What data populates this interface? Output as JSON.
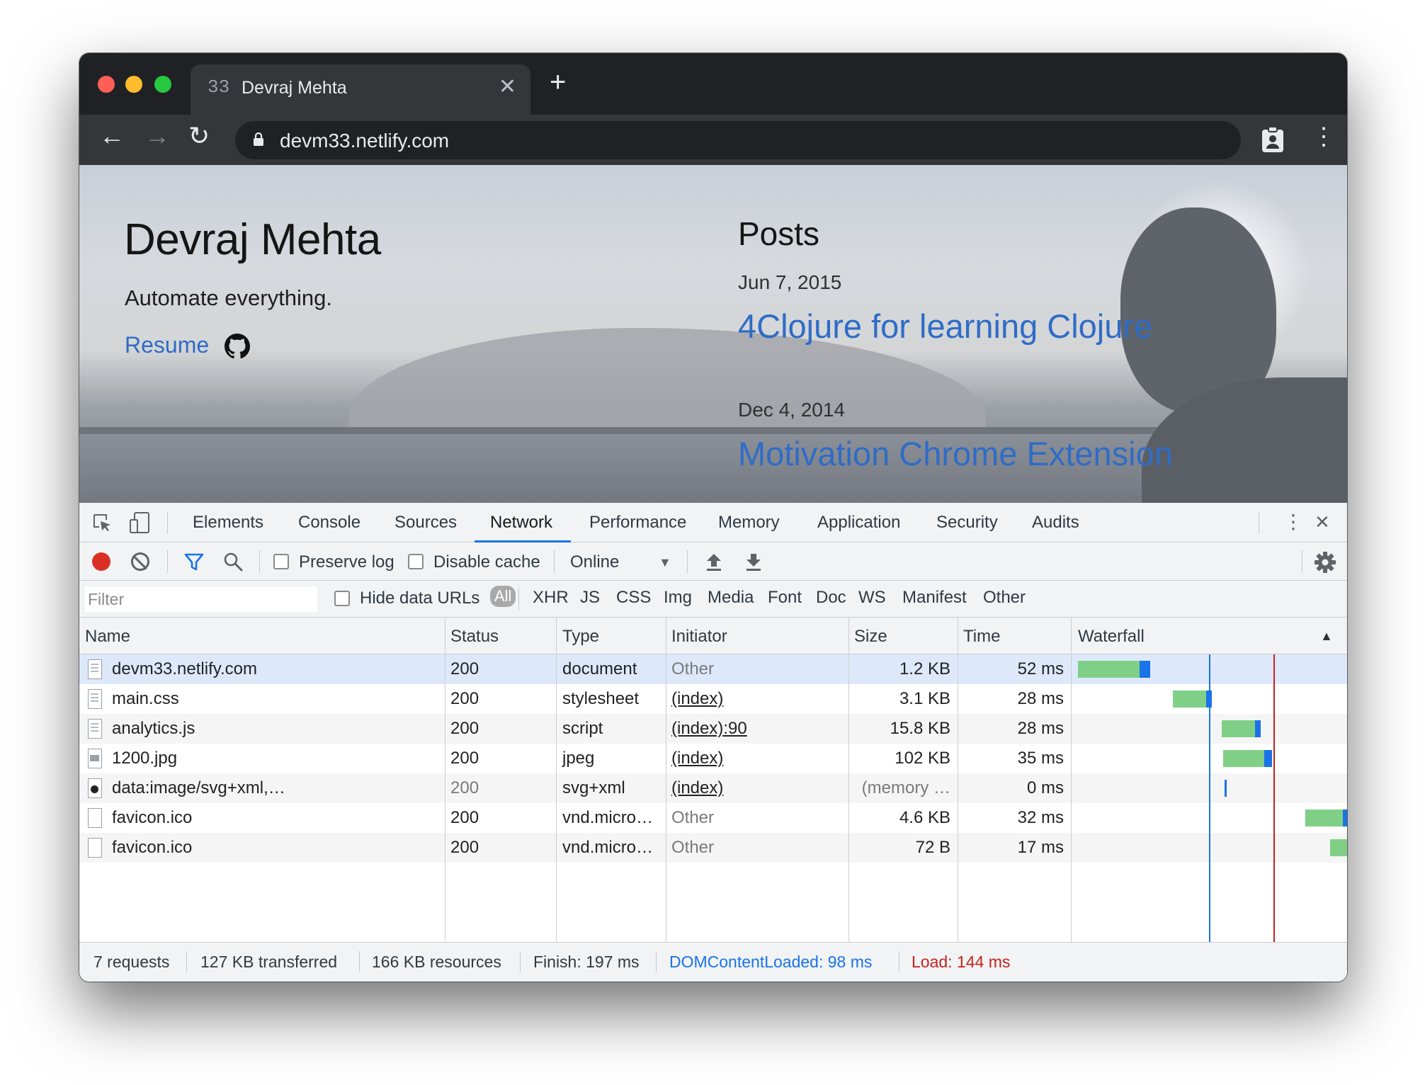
{
  "browser": {
    "tab_favicon": "33",
    "tab_title": "Devraj Mehta",
    "tab_close": "✕",
    "new_tab": "+",
    "back": "←",
    "forward": "→",
    "reload": "↻",
    "url": "devm33.netlify.com",
    "menu": "⋮"
  },
  "page": {
    "name": "Devraj Mehta",
    "tagline": "Automate everything.",
    "resume": "Resume",
    "posts_heading": "Posts",
    "posts": [
      {
        "date": "Jun 7, 2015",
        "title": "4Clojure for learning Clojure"
      },
      {
        "date": "Dec 4, 2014",
        "title": "Motivation Chrome Extension"
      }
    ]
  },
  "devtools": {
    "tabs": [
      "Elements",
      "Console",
      "Sources",
      "Network",
      "Performance",
      "Memory",
      "Application",
      "Security",
      "Audits"
    ],
    "active_tab": "Network",
    "more": "⋮",
    "close": "✕",
    "toolbar": {
      "preserve_log": "Preserve log",
      "disable_cache": "Disable cache",
      "throttle": "Online",
      "throttle_arrow": "▼"
    },
    "filter": {
      "placeholder": "Filter",
      "hide_data_urls": "Hide data URLs",
      "types": [
        "All",
        "XHR",
        "JS",
        "CSS",
        "Img",
        "Media",
        "Font",
        "Doc",
        "WS",
        "Manifest",
        "Other"
      ]
    },
    "columns": [
      "Name",
      "Status",
      "Type",
      "Initiator",
      "Size",
      "Time",
      "Waterfall"
    ],
    "sort_indicator": "▲",
    "requests": [
      {
        "name": "devm33.netlify.com",
        "status": "200",
        "type": "document",
        "initiator": "Other",
        "size": "1.2 KB",
        "time": "52 ms",
        "icon": "doc"
      },
      {
        "name": "main.css",
        "status": "200",
        "type": "stylesheet",
        "initiator": "(index)",
        "size": "3.1 KB",
        "time": "28 ms",
        "icon": "doc"
      },
      {
        "name": "analytics.js",
        "status": "200",
        "type": "script",
        "initiator": "(index):90",
        "size": "15.8 KB",
        "time": "28 ms",
        "icon": "doc"
      },
      {
        "name": "1200.jpg",
        "status": "200",
        "type": "jpeg",
        "initiator": "(index)",
        "size": "102 KB",
        "time": "35 ms",
        "icon": "img"
      },
      {
        "name": "data:image/svg+xml,…",
        "status": "200",
        "type": "svg+xml",
        "initiator": "(index)",
        "size": "(memory …",
        "time": "0 ms",
        "icon": "gh"
      },
      {
        "name": "favicon.ico",
        "status": "200",
        "type": "vnd.micro…",
        "initiator": "Other",
        "size": "4.6 KB",
        "time": "32 ms",
        "icon": "blank"
      },
      {
        "name": "favicon.ico",
        "status": "200",
        "type": "vnd.micro…",
        "initiator": "Other",
        "size": "72 B",
        "time": "17 ms",
        "icon": "blank"
      }
    ],
    "status_bar": {
      "requests": "7 requests",
      "transferred": "127 KB transferred",
      "resources": "166 KB resources",
      "finish": "Finish: 197 ms",
      "dom_content_loaded": "DOMContentLoaded: 98 ms",
      "load": "Load: 144 ms"
    },
    "colors": {
      "dom_content_loaded": "#1a73e8",
      "load": "#c5221f",
      "bar_wait": "#7fd086",
      "bar_receive": "#1a73e8"
    }
  }
}
